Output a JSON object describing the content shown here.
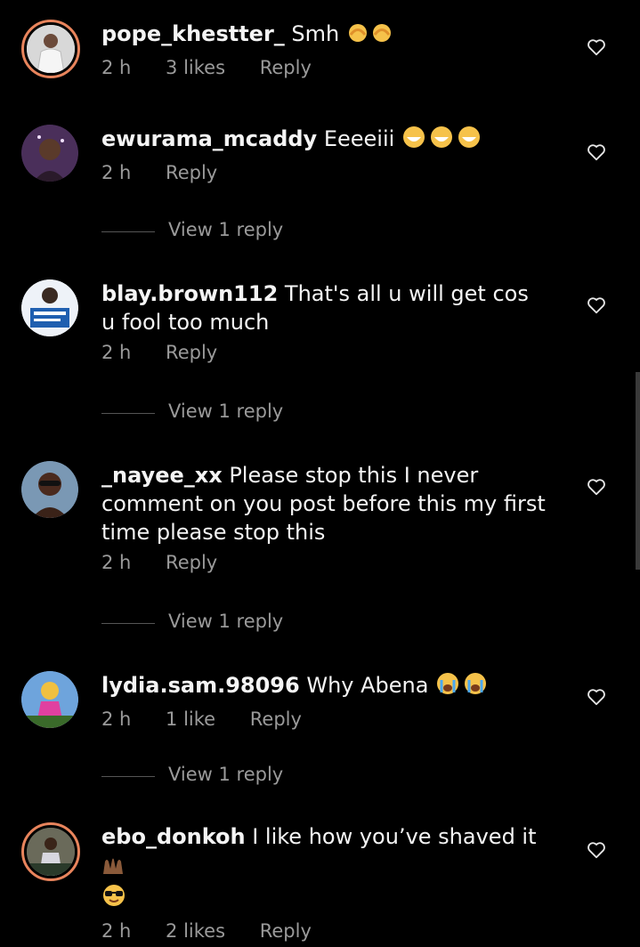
{
  "comments": [
    {
      "user": "pope_khestter_",
      "text": " Smh",
      "emoji": "facepalm",
      "time": "2 h",
      "likes": "3 likes",
      "reply": "Reply",
      "view_replies": ""
    },
    {
      "user": "ewurama_mcaddy",
      "text": " Eeeeiii",
      "emoji": "laugh",
      "time": "2 h",
      "likes": "",
      "reply": "Reply",
      "view_replies": "View 1 reply"
    },
    {
      "user": "blay.brown112",
      "text": " That's all u will get cos u fool too much",
      "emoji": "",
      "time": "2 h",
      "likes": "",
      "reply": "Reply",
      "view_replies": "View 1 reply"
    },
    {
      "user": "_nayee_xx",
      "text": " Please stop this I never comment on you post before this my first time please stop this",
      "emoji": "",
      "time": "2 h",
      "likes": "",
      "reply": "Reply",
      "view_replies": "View 1 reply"
    },
    {
      "user": "lydia.sam.98096",
      "text": " Why Abena",
      "emoji": "cry",
      "time": "2 h",
      "likes": "1 like",
      "reply": "Reply",
      "view_replies": "View 1 reply"
    },
    {
      "user": "ebo_donkoh",
      "text": " I like how you’ve shaved it",
      "emoji": "hands-cool",
      "time": "2 h",
      "likes": "2 likes",
      "reply": "Reply",
      "view_replies": ""
    }
  ],
  "colors": {
    "background": "#000000",
    "meta": "#9a9a9a",
    "story_ring": "#e8845c"
  }
}
